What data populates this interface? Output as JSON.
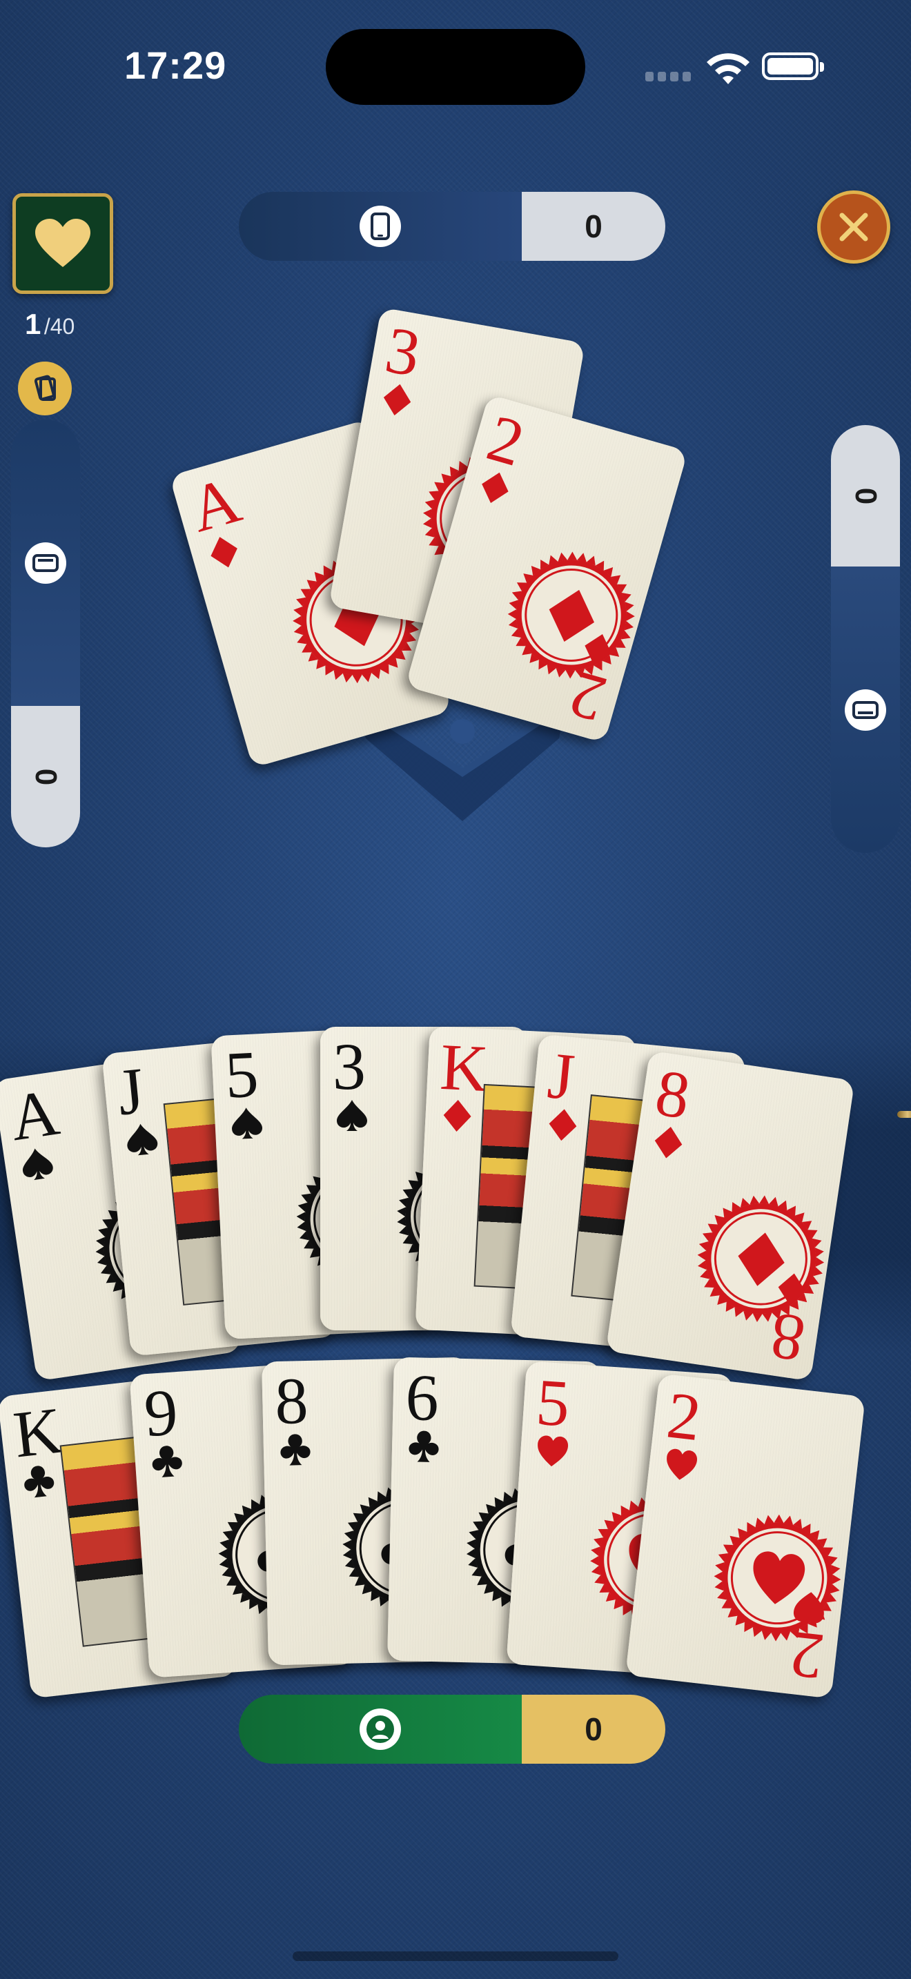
{
  "status_bar": {
    "time": "17:29"
  },
  "trump": {
    "suit": "hearts",
    "icon": "heart-icon"
  },
  "round": {
    "current": "1",
    "total": "/40"
  },
  "opponent_top": {
    "icon": "phone-icon",
    "score": "0"
  },
  "opponent_left": {
    "icon": "tablet-icon",
    "score": "0"
  },
  "opponent_right": {
    "icon": "tablet-icon",
    "score": "0"
  },
  "player": {
    "icon": "person-icon",
    "score": "0"
  },
  "colors": {
    "felt": "#203f6e",
    "gold": "#e3b84a",
    "player_green": "#0f6a35",
    "card_red": "#d0171c"
  },
  "table_cards": [
    {
      "rank": "A",
      "suit": "diamonds"
    },
    {
      "rank": "3",
      "suit": "diamonds"
    },
    {
      "rank": "2",
      "suit": "diamonds"
    }
  ],
  "hand_row1": [
    {
      "rank": "A",
      "suit": "spades"
    },
    {
      "rank": "J",
      "suit": "spades"
    },
    {
      "rank": "5",
      "suit": "spades"
    },
    {
      "rank": "3",
      "suit": "spades"
    },
    {
      "rank": "K",
      "suit": "diamonds"
    },
    {
      "rank": "J",
      "suit": "diamonds"
    },
    {
      "rank": "8",
      "suit": "diamonds"
    }
  ],
  "hand_row2": [
    {
      "rank": "K",
      "suit": "clubs"
    },
    {
      "rank": "9",
      "suit": "clubs"
    },
    {
      "rank": "8",
      "suit": "clubs"
    },
    {
      "rank": "6",
      "suit": "clubs"
    },
    {
      "rank": "5",
      "suit": "hearts"
    },
    {
      "rank": "2",
      "suit": "hearts"
    }
  ]
}
